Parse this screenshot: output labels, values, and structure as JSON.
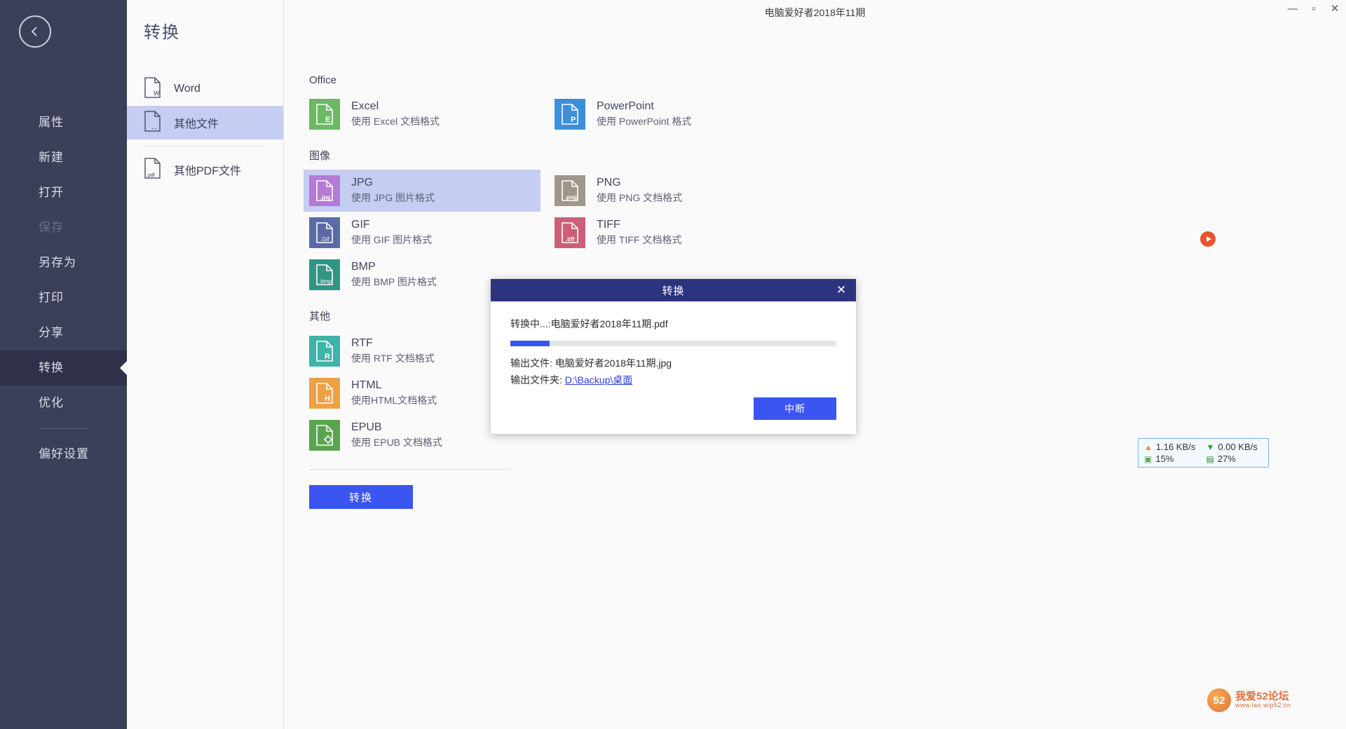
{
  "window": {
    "title": "电脑爱好者2018年11期",
    "controls": [
      {
        "name": "minimize",
        "glyph": "—"
      },
      {
        "name": "maximize",
        "glyph": "▫"
      },
      {
        "name": "close",
        "glyph": "✕"
      }
    ]
  },
  "rail": {
    "back_icon": "back-chevron-icon",
    "items": [
      {
        "label": "属性",
        "state": "normal"
      },
      {
        "label": "新建",
        "state": "normal"
      },
      {
        "label": "打开",
        "state": "normal"
      },
      {
        "label": "保存",
        "state": "disabled"
      },
      {
        "label": "另存为",
        "state": "normal"
      },
      {
        "label": "打印",
        "state": "normal"
      },
      {
        "label": "分享",
        "state": "normal"
      },
      {
        "label": "转换",
        "state": "active"
      },
      {
        "label": "优化",
        "state": "normal"
      }
    ],
    "footer_item": {
      "label": "偏好设置",
      "state": "normal"
    }
  },
  "categories": {
    "title": "转换",
    "items": [
      {
        "label": "Word",
        "icon": "file-w-icon",
        "badge": "W",
        "selected": false
      },
      {
        "label": "其他文件",
        "icon": "file-dots-icon",
        "badge": "...",
        "selected": true
      },
      {
        "label": "其他PDF文件",
        "icon": "file-pdf-icon",
        "badge": ".pdf",
        "selected": false
      }
    ]
  },
  "main": {
    "sections": [
      {
        "title": "Office",
        "formats": [
          {
            "name": "Excel",
            "desc": "使用 Excel 文档格式",
            "badge": "E",
            "color": "#6cb865",
            "selected": false
          },
          {
            "name": "PowerPoint",
            "desc": "使用 PowerPoint 格式",
            "badge": "P",
            "color": "#3b90d9",
            "selected": false
          }
        ]
      },
      {
        "title": "图像",
        "formats": [
          {
            "name": "JPG",
            "desc": "使用 JPG 图片格式",
            "badge": ".jpg",
            "color": "#b57ad6",
            "selected": true
          },
          {
            "name": "PNG",
            "desc": "使用 PNG 文档格式",
            "badge": ".png",
            "color": "#a1968c",
            "selected": false
          },
          {
            "name": "GIF",
            "desc": "使用 GIF 图片格式",
            "badge": ".Gif",
            "color": "#5b6ba8",
            "selected": false
          },
          {
            "name": "TIFF",
            "desc": "使用 TIFF 文档格式",
            "badge": ".tiff",
            "color": "#cc6079",
            "selected": false
          },
          {
            "name": "BMP",
            "desc": "使用 BMP 图片格式",
            "badge": ".bmp",
            "color": "#2f9585",
            "selected": false
          }
        ]
      },
      {
        "title": "其他",
        "formats": [
          {
            "name": "RTF",
            "desc": "使用 RTF 文档格式",
            "badge": "R",
            "color": "#3fb3a8",
            "selected": false
          },
          {
            "name": "HTML",
            "desc": "使用HTML文档格式",
            "badge": "H",
            "color": "#eda145",
            "selected": false
          },
          {
            "name": "EPUB",
            "desc": "使用 EPUB 文档格式",
            "badge": "◇",
            "color": "#5ba44f",
            "selected": false
          }
        ]
      }
    ],
    "convert_button": "转换"
  },
  "dialog": {
    "title": "转换",
    "close_glyph": "✕",
    "status_text": "转换中...:电脑爱好者2018年11期.pdf",
    "progress_percent": 12,
    "output_file_label": "输出文件:",
    "output_file_value": "电脑爱好者2018年11期.jpg",
    "output_folder_label": "输出文件夹:",
    "output_folder_value": "D:\\Backup\\桌面",
    "abort_button": "中断"
  },
  "net_widget": {
    "upload": "1.16 KB/s",
    "download": "0.00 KB/s",
    "cpu": "15%",
    "memory": "27%",
    "upload_icon": "arrow-up-icon",
    "download_icon": "arrow-down-icon",
    "cpu_icon": "cpu-chip-icon",
    "memory_icon": "memory-stick-icon"
  },
  "watermark": {
    "main": "我爱52论坛",
    "sub": "www.iao.wip52.cn",
    "mark": "52"
  },
  "colors": {
    "rail_bg": "#3b3f59",
    "rail_active": "#2e3149",
    "selection": "#c5cdf2",
    "accent": "#3b55f0",
    "dialog_bar": "#2c3480"
  }
}
